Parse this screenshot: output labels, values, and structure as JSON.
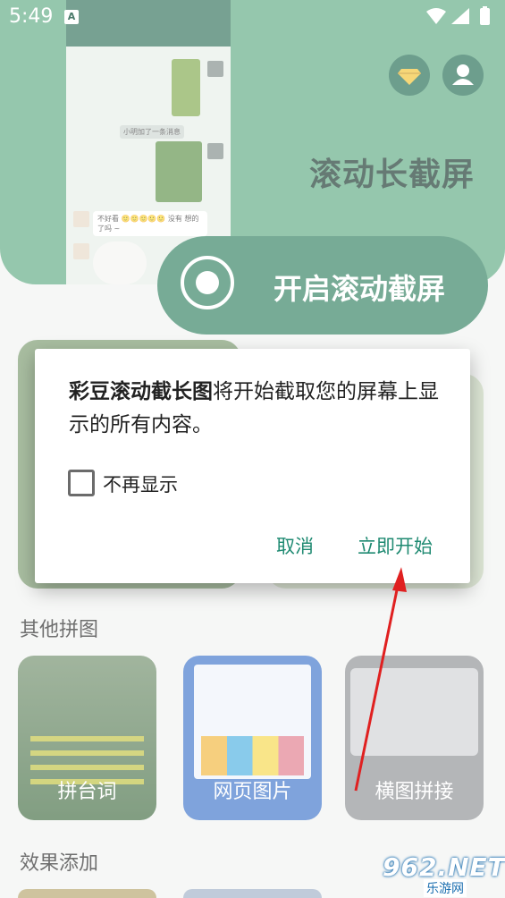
{
  "status_bar": {
    "time": "5:49",
    "notification_badge": "A"
  },
  "hero": {
    "title": "滚动长截屏",
    "start_button_label": "开启滚动截屏",
    "preview_chat": {
      "system_message": "小明加了一条消息",
      "bubble_text": "不好看 🙂🙂🙂🙂🙂 没有 想的了吗 ~"
    },
    "accent_color": "#2e7f5e"
  },
  "sections": {
    "other_collage_title": "其他拼图",
    "other_collage_tiles": [
      {
        "label": "拼台词",
        "icon": "subtitle-collage-thumbnail"
      },
      {
        "label": "网页图片",
        "icon": "webpage-thumbnail"
      },
      {
        "label": "横图拼接",
        "icon": "horizontal-stitch-thumbnail"
      }
    ],
    "effects_title": "效果添加"
  },
  "dialog": {
    "app_name": "彩豆滚动截长图",
    "message_rest": "将开始截取您的屏幕上显示的所有内容。",
    "checkbox_label": "不再显示",
    "checkbox_checked": false,
    "cancel_label": "取消",
    "confirm_label": "立即开始",
    "button_color": "#1f8a72"
  },
  "watermark": {
    "logo_text": "962.NET",
    "sub_text": "乐游网"
  },
  "annotation": {
    "arrow_color": "#e02020"
  }
}
